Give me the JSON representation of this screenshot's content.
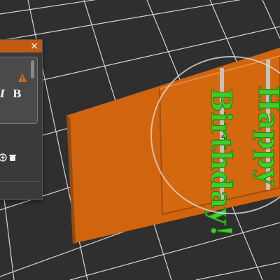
{
  "panel": {
    "close_glyph": "×",
    "style_buttons": {
      "italic": "I",
      "bold": "B"
    }
  },
  "model": {
    "word_top": "Happy",
    "word_bottom": "Birthday!"
  },
  "colors": {
    "background": "#2f2f2f",
    "grid": "#ffffff",
    "board": "#d0640f",
    "board_edge": "#9c4a08",
    "text_green": "#3ccf2a",
    "accent": "#c05a14",
    "support": "#c8c0b8"
  },
  "icons": {
    "close": "close-icon",
    "warning": "warning-icon",
    "add": "add-icon",
    "delete": "delete-icon",
    "rotate_gizmo": "rotate-gizmo-icon"
  }
}
